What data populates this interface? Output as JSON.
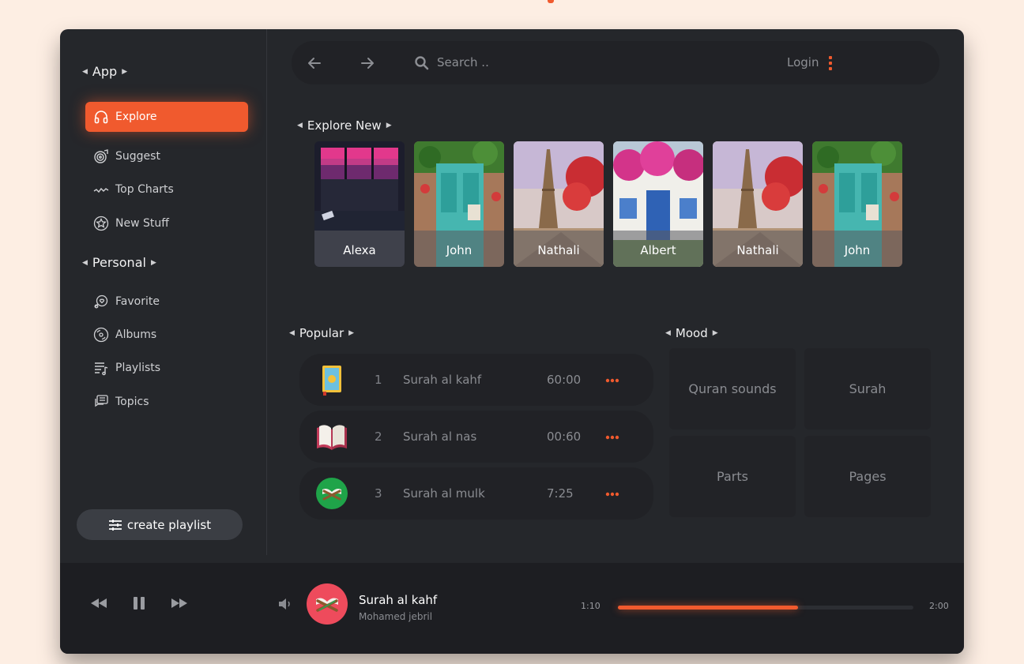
{
  "sidebar": {
    "app_section": "App",
    "app_items": [
      {
        "label": "Explore",
        "icon": "headphones-icon",
        "active": true
      },
      {
        "label": "Suggest",
        "icon": "vinyl-icon",
        "active": false
      },
      {
        "label": "Top Charts",
        "icon": "wave-icon",
        "active": false
      },
      {
        "label": "New Stuff",
        "icon": "star-badge-icon",
        "active": false
      }
    ],
    "personal_section": "Personal",
    "personal_items": [
      {
        "label": "Favorite",
        "icon": "favorite-icon"
      },
      {
        "label": "Albums",
        "icon": "disc-icon"
      },
      {
        "label": "Playlists",
        "icon": "playlist-icon"
      },
      {
        "label": "Topics",
        "icon": "chat-icon"
      }
    ],
    "create_button": "create playlist"
  },
  "topbar": {
    "search_placeholder": "Search ..",
    "login_label": "Login"
  },
  "explore": {
    "heading": "Explore New",
    "cards": [
      "Alexa",
      "John",
      "Nathali",
      "Albert",
      "Nathali",
      "John"
    ]
  },
  "popular": {
    "heading": "Popular",
    "tracks": [
      {
        "num": "1",
        "title": "Surah al kahf",
        "duration": "60:00"
      },
      {
        "num": "2",
        "title": "Surah al nas",
        "duration": "00:60"
      },
      {
        "num": "3",
        "title": "Surah al mulk",
        "duration": "7:25"
      }
    ]
  },
  "mood": {
    "heading": "Mood",
    "tiles": [
      "Quran sounds",
      "Surah",
      "Parts",
      "Pages"
    ]
  },
  "player": {
    "title": "Surah al kahf",
    "artist": "Mohamed jebril",
    "elapsed": "1:10",
    "total": "2:00",
    "progress": 0.61
  },
  "colors": {
    "accent": "#f05a2e",
    "background": "#25272b",
    "page": "#fdeee3"
  }
}
